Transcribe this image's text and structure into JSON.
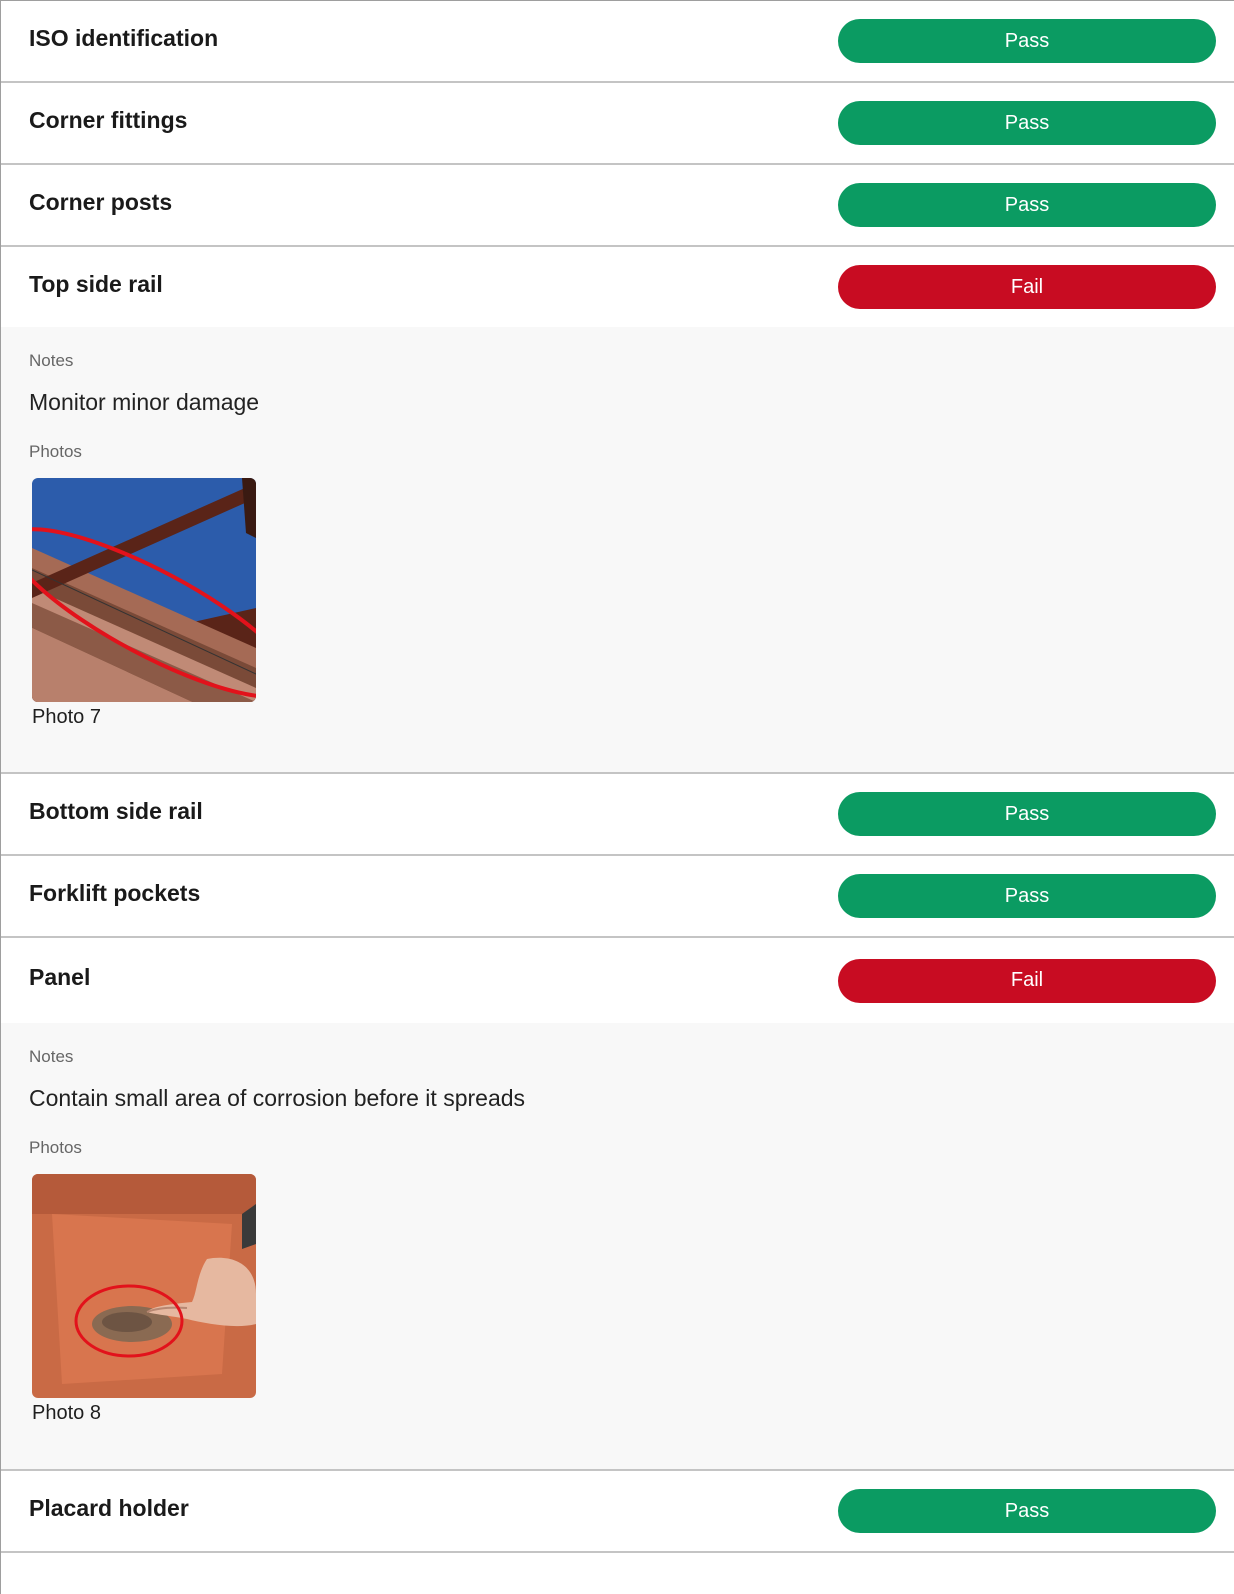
{
  "checklist": [
    {
      "label": "ISO identification",
      "status": "Pass"
    },
    {
      "label": "Corner fittings",
      "status": "Pass"
    },
    {
      "label": "Corner posts",
      "status": "Pass"
    },
    {
      "label": "Top side rail",
      "status": "Fail",
      "notes_label": "Notes",
      "note": "Monitor minor damage",
      "photos_label": "Photos",
      "photo_caption": "Photo 7"
    },
    {
      "label": "Bottom side rail",
      "status": "Pass"
    },
    {
      "label": "Forklift pockets",
      "status": "Pass"
    },
    {
      "label": "Panel",
      "status": "Fail",
      "notes_label": "Notes",
      "note": "Contain small area of corrosion before it spreads",
      "photos_label": "Photos",
      "photo_caption": "Photo 8"
    },
    {
      "label": "Placard holder",
      "status": "Pass"
    }
  ],
  "colors": {
    "pass": "#0b9b62",
    "fail": "#c80c22",
    "details_bg": "#f8f8f8",
    "annotation": "#e2121b"
  }
}
